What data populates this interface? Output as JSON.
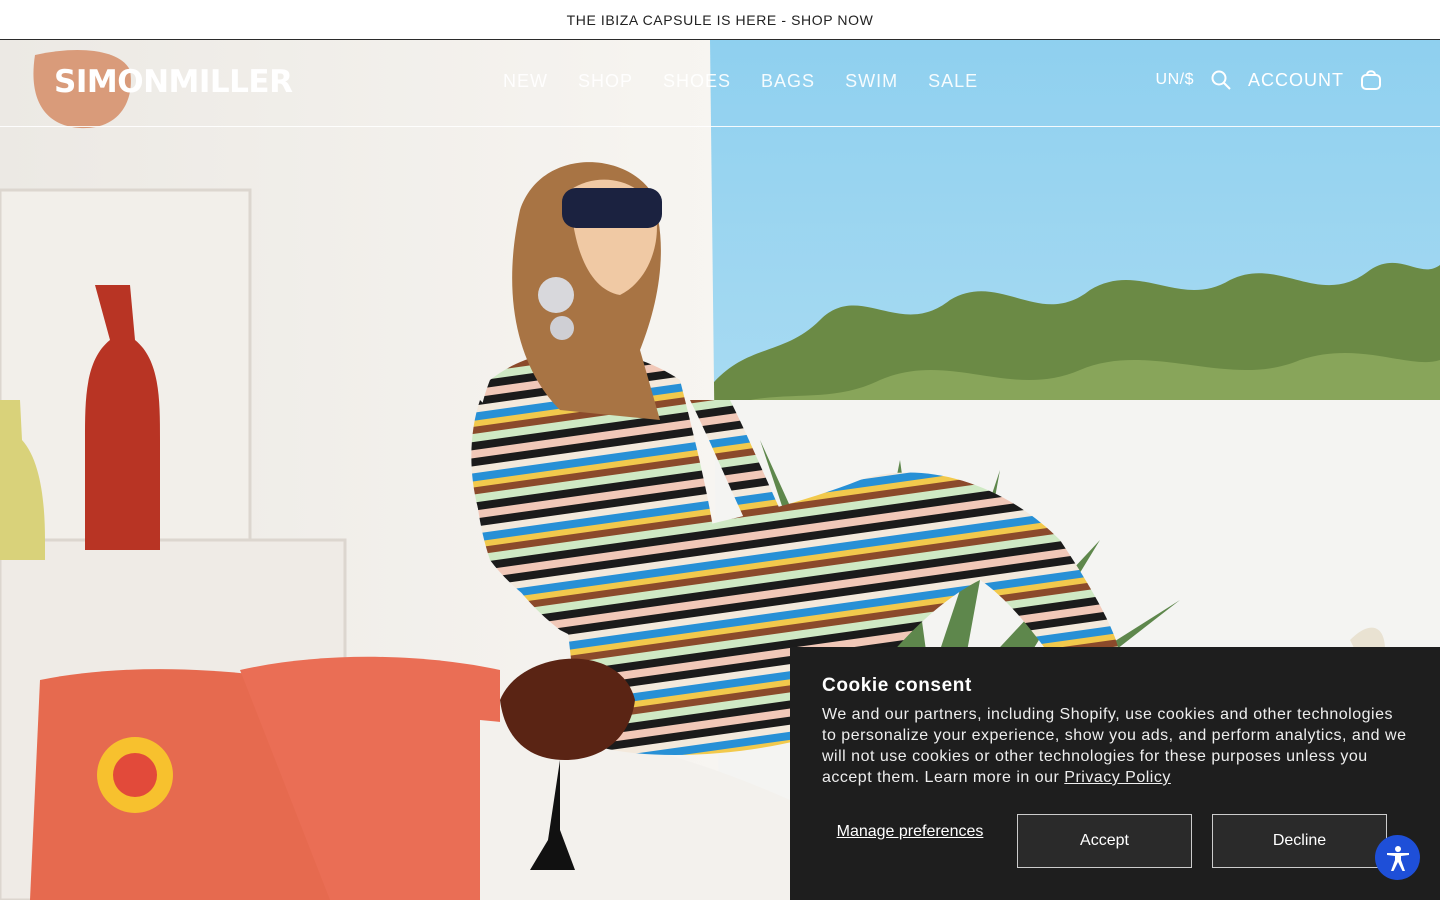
{
  "announcement": "THE IBIZA CAPSULE IS HERE - SHOP NOW",
  "brand": "SIMONMILLER",
  "nav": [
    "NEW",
    "SHOP",
    "SHOES",
    "BAGS",
    "SWIM",
    "SALE"
  ],
  "utility": {
    "currency": "UN/$",
    "account": "ACCOUNT"
  },
  "cookie": {
    "title": "Cookie consent",
    "body": "We and our partners, including Shopify, use cookies and other technologies to personalize your experience, show you ads, and perform analytics, and we will not use cookies or other technologies for these purposes unless you accept them. Learn more in our ",
    "link": "Privacy Policy",
    "manage": "Manage preferences",
    "accept": "Accept",
    "decline": "Decline"
  },
  "icons": [
    "search-icon",
    "cart-icon",
    "accessibility-icon"
  ],
  "colors": {
    "cookie_bg": "#1e1e1e",
    "a11y": "#1e4fd8",
    "sky": "#9fd4ee"
  }
}
